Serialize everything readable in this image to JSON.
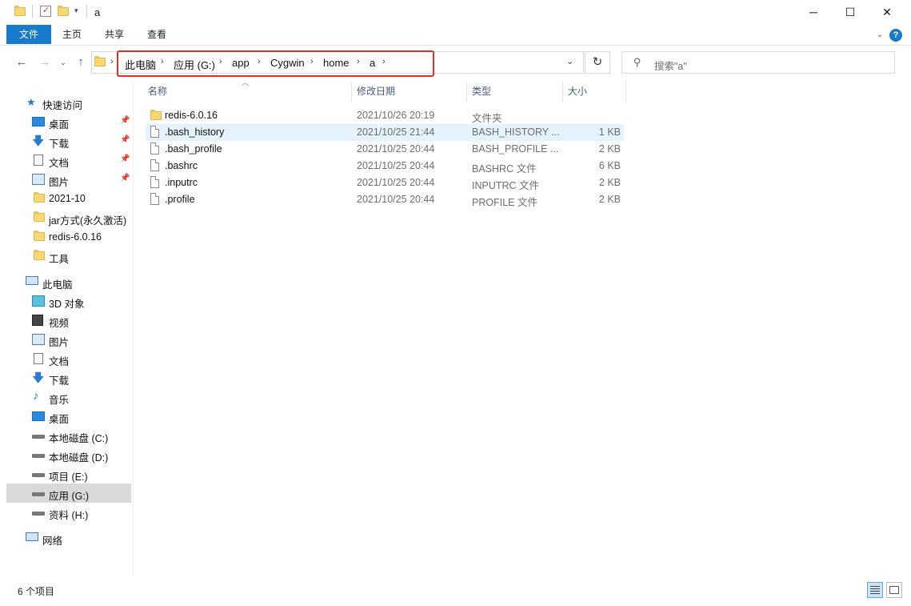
{
  "window": {
    "title": "a",
    "controls": {
      "minimize": "─",
      "maximize": "☐",
      "close": "✕"
    }
  },
  "ribbon": {
    "tabs": [
      "文件",
      "主页",
      "共享",
      "查看"
    ],
    "help": "?"
  },
  "address": {
    "crumbs": [
      "此电脑",
      "应用 (G:)",
      "app",
      "Cygwin",
      "home",
      "a"
    ],
    "search_placeholder": "搜索\"a\""
  },
  "columns": {
    "name": "名称",
    "date": "修改日期",
    "type": "类型",
    "size": "大小"
  },
  "files": [
    {
      "name": "redis-6.0.16",
      "date": "2021/10/26 20:19",
      "type": "文件夹",
      "size": "",
      "kind": "folder"
    },
    {
      "name": ".bash_history",
      "date": "2021/10/25 21:44",
      "type": "BASH_HISTORY ...",
      "size": "1 KB",
      "kind": "file"
    },
    {
      "name": ".bash_profile",
      "date": "2021/10/25 20:44",
      "type": "BASH_PROFILE ...",
      "size": "2 KB",
      "kind": "file"
    },
    {
      "name": ".bashrc",
      "date": "2021/10/25 20:44",
      "type": "BASHRC 文件",
      "size": "6 KB",
      "kind": "file"
    },
    {
      "name": ".inputrc",
      "date": "2021/10/25 20:44",
      "type": "INPUTRC 文件",
      "size": "2 KB",
      "kind": "file"
    },
    {
      "name": ".profile",
      "date": "2021/10/25 20:44",
      "type": "PROFILE 文件",
      "size": "2 KB",
      "kind": "file"
    }
  ],
  "nav": {
    "quick_access": "快速访问",
    "quick_items": [
      "桌面",
      "下载",
      "文档",
      "图片",
      "2021-10",
      "jar方式(永久激活)",
      "redis-6.0.16",
      "工具"
    ],
    "this_pc": "此电脑",
    "pc_items": [
      "3D 对象",
      "视频",
      "图片",
      "文档",
      "下载",
      "音乐",
      "桌面",
      "本地磁盘 (C:)",
      "本地磁盘 (D:)",
      "项目 (E:)",
      "应用 (G:)",
      "资料 (H:)"
    ],
    "network": "网络"
  },
  "status": {
    "count": "6 个项目"
  }
}
